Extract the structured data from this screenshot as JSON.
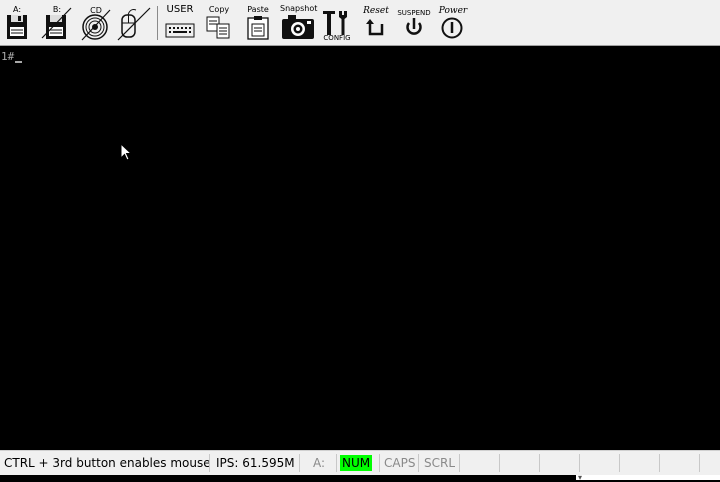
{
  "toolbar": {
    "floppy_a_label": "A:",
    "floppy_b_label": "B:",
    "cd_label": "CD",
    "user_label": "USER",
    "copy_label": "Copy",
    "paste_label": "Paste",
    "snapshot_label": "Snapshot",
    "config_label": "CONFIG",
    "reset_label": "Reset",
    "suspend_label": "SUSPEND",
    "power_label": "Power"
  },
  "screen": {
    "prompt": "1#"
  },
  "statusbar": {
    "hint": "CTRL + 3rd button enables mouse",
    "ips": "IPS: 61.595M",
    "drive": "A:",
    "num": "NUM",
    "caps": "CAPS",
    "scrl": "SCRL"
  },
  "colors": {
    "num_indicator": "#00ff00",
    "screen_bg": "#000000",
    "toolbar_bg": "#f0f0f0"
  }
}
